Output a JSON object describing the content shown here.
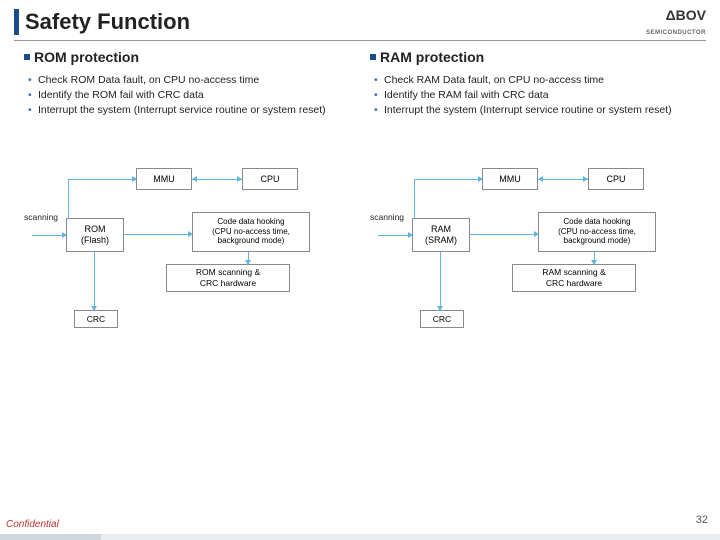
{
  "title": "Safety Function",
  "logo": {
    "brand": "ΔBOV",
    "sub": "SEMICONDUCTOR"
  },
  "left": {
    "heading": "ROM protection",
    "bullets": [
      "Check ROM Data fault, on CPU no-access time",
      "Identify the ROM fail with CRC data",
      "Interrupt the system (Interrupt service routine or system reset)"
    ],
    "diagram": {
      "mmu": "MMU",
      "cpu": "CPU",
      "scanning": "scanning",
      "mem": "ROM\n(Flash)",
      "hook": "Code data hooking\n(CPU no-access time,\nbackground mode)",
      "scan": "ROM scanning &\nCRC hardware",
      "crc": "CRC"
    }
  },
  "right": {
    "heading": "RAM protection",
    "bullets": [
      "Check RAM Data fault, on CPU no-access time",
      "Identify the RAM fail with CRC data",
      "Interrupt the system (Interrupt service routine or system reset)"
    ],
    "diagram": {
      "mmu": "MMU",
      "cpu": "CPU",
      "scanning": "scanning",
      "mem": "RAM\n(SRAM)",
      "hook": "Code data hooking\n(CPU no-access time,\nbackground mode)",
      "scan": "RAM scanning &\nCRC hardware",
      "crc": "CRC"
    }
  },
  "footer": {
    "confidential": "Confidential",
    "page": "32"
  }
}
